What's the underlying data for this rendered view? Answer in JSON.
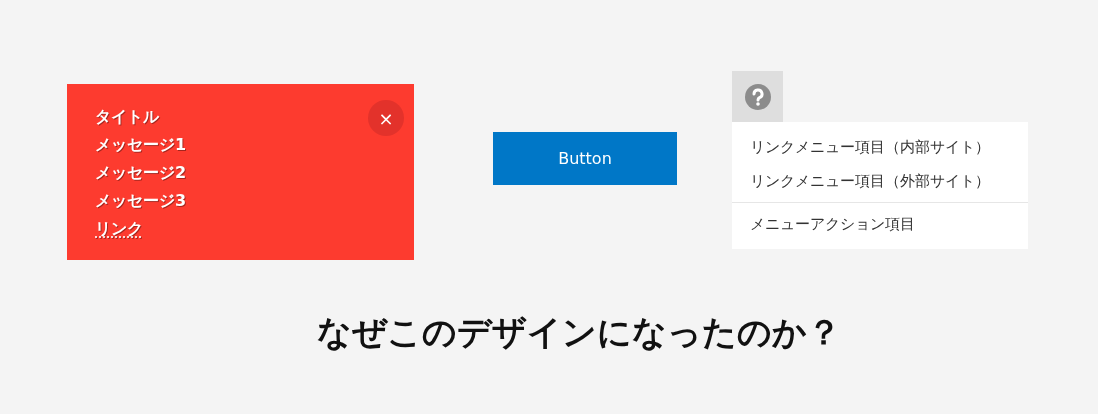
{
  "notification": {
    "lines": [
      "タイトル",
      "メッセージ1",
      "メッセージ2",
      "メッセージ3"
    ],
    "link": "リンク",
    "close_label": "×"
  },
  "button": {
    "label": "Button"
  },
  "help_menu": {
    "groups": [
      {
        "items": [
          "リンクメニュー項目（内部サイト）",
          "リンクメニュー項目（外部サイト）"
        ]
      },
      {
        "items": [
          "メニューアクション項目"
        ]
      }
    ]
  },
  "heading": "なぜこのデザインになったのか？"
}
